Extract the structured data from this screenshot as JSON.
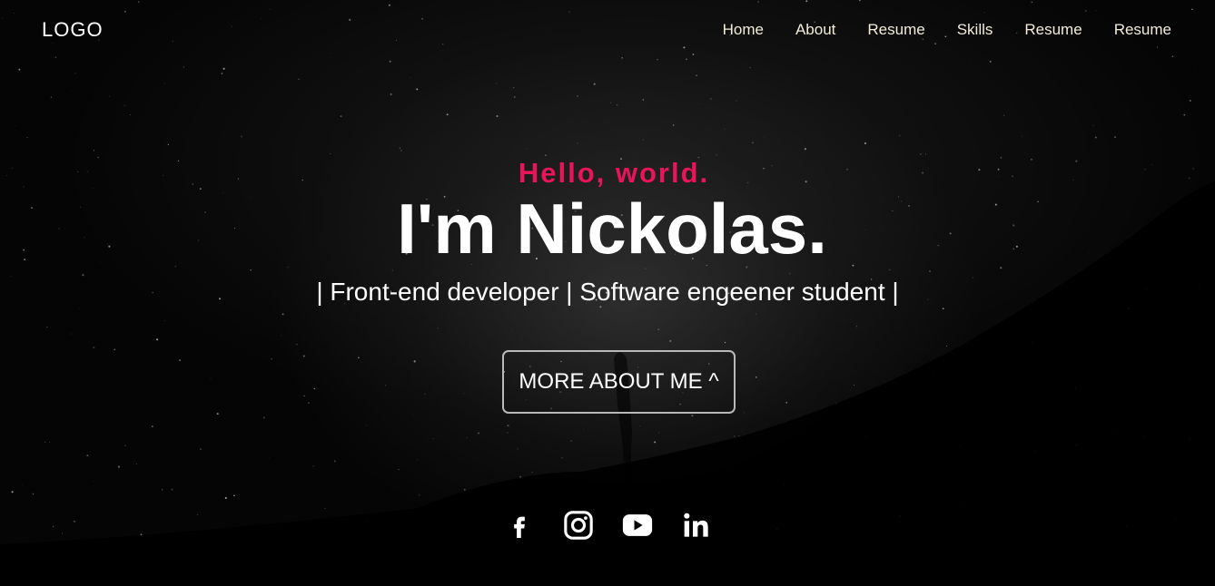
{
  "navbar": {
    "logo": "LOGO",
    "links": [
      {
        "label": "Home"
      },
      {
        "label": "About"
      },
      {
        "label": "Resume"
      },
      {
        "label": "Skills"
      },
      {
        "label": "Resume"
      },
      {
        "label": "Resume"
      }
    ]
  },
  "hero": {
    "greeting": "Hello, world.",
    "name": "I'm Nickolas.",
    "subtitle": "| Front-end developer | Software engeener student |",
    "cta_label": "MORE ABOUT ME ^"
  },
  "social": [
    {
      "icon": "facebook-icon"
    },
    {
      "icon": "instagram-icon"
    },
    {
      "icon": "youtube-icon"
    },
    {
      "icon": "linkedin-icon"
    }
  ],
  "colors": {
    "accent": "#e8155a",
    "nav_text": "#f2ecd9",
    "background": "#050505",
    "text": "#ffffff"
  }
}
